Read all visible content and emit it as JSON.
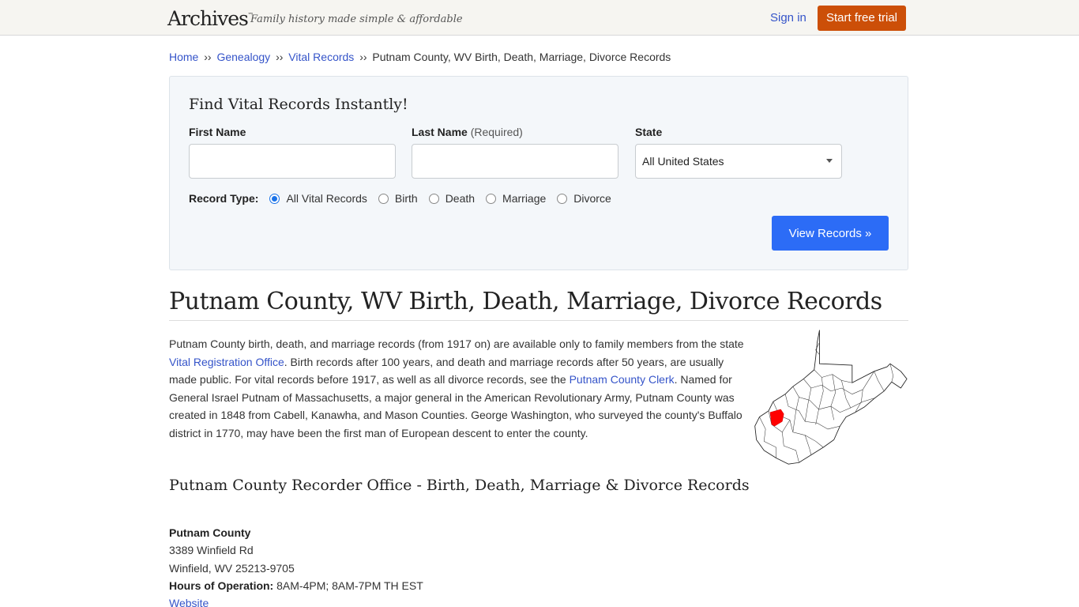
{
  "header": {
    "logo": "Archives",
    "logo_tm": "™",
    "tagline": "Family history made simple & affordable",
    "signin_label": "Sign in",
    "trial_label": "Start free trial",
    "accent_color": "#cc4f08",
    "link_color": "#3554c9"
  },
  "breadcrumb": {
    "items": [
      "Home",
      "Genealogy",
      "Vital Records"
    ],
    "separator": "››",
    "current": "Putnam County, WV Birth, Death, Marriage, Divorce Records"
  },
  "search": {
    "title": "Find Vital Records Instantly!",
    "first_name_label": "First Name",
    "first_name_value": "",
    "last_name_label": "Last Name",
    "last_name_required": "(Required)",
    "last_name_value": "",
    "state_label": "State",
    "state_selected": "All United States",
    "record_type_label": "Record Type:",
    "record_types": [
      "All Vital Records",
      "Birth",
      "Death",
      "Marriage",
      "Divorce"
    ],
    "record_type_selected": "All Vital Records",
    "submit_label": "View Records »",
    "submit_color": "#2c6cf6"
  },
  "page": {
    "title": "Putnam County, WV Birth, Death, Marriage, Divorce Records",
    "intro": {
      "t1": "Putnam County birth, death, and marriage records (from 1917 on) are available only to family members from the state ",
      "link1": "Vital Registration Office",
      "t2": ". Birth records after 100 years, and death and marriage records after 50 years, are usually made public. For vital records before 1917, as well as all divorce records, see the ",
      "link2": "Putnam County Clerk",
      "t3": ". Named for General Israel Putnam of Massachusetts, a major general in the American Revolutionary Army, Putnam County was created in 1848 from Cabell, Kanawha, and Mason Counties. George Washington, who surveyed the county's Buffalo district in 1770, may have been the first man of European descent to enter the county."
    },
    "map_highlight_color": "#ff0000",
    "office_heading": "Putnam County Recorder Office - Birth, Death, Marriage & Divorce Records",
    "office": {
      "name": "Putnam County",
      "address1": "3389 Winfield Rd",
      "address2": "Winfield, WV 25213-9705",
      "hours_label": "Hours of Operation:",
      "hours": "8AM-4PM; 8AM-7PM TH EST",
      "website_label": "Website"
    }
  }
}
